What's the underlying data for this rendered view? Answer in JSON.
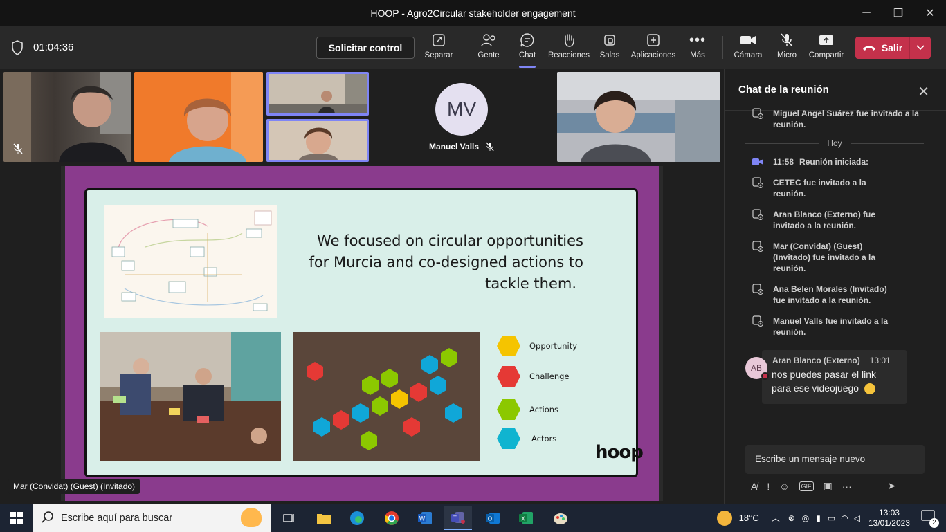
{
  "window": {
    "title": "HOOP - Agro2Circular stakeholder engagement",
    "minimize": "─",
    "maximize": "❐",
    "close": "✕"
  },
  "toolbar": {
    "timer": "01:04:36",
    "request_control": "Solicitar control",
    "buttons": {
      "separar": "Separar",
      "gente": "Gente",
      "chat": "Chat",
      "reacciones": "Reacciones",
      "salas": "Salas",
      "aplicaciones": "Aplicaciones",
      "mas": "Más",
      "camara": "Cámara",
      "micro": "Micro",
      "compartir": "Compartir"
    },
    "leave": "Salir"
  },
  "participants": {
    "manuel_initials": "MV",
    "manuel_name": "Manuel Valls",
    "presenter_tag": "Mar (Convidat) (Guest) (Invitado)"
  },
  "slide": {
    "heading_line1": "We focused on circular opportunities",
    "heading_line2": "for Murcia and co-designed actions to",
    "heading_line3": "tackle them.",
    "legend": [
      "Opportunity",
      "Challenge",
      "Actions",
      "Actors"
    ],
    "legend_colors": [
      "#f5c400",
      "#e53935",
      "#8cc800",
      "#10b4d0"
    ],
    "logo": "hoop"
  },
  "chat": {
    "title": "Chat de la reunión",
    "events_before": [
      "Miguel Angel Suárez fue invitado a la reunión."
    ],
    "day_divider": "Hoy",
    "meeting_started_time": "11:58",
    "meeting_started_text": "Reunión iniciada:",
    "events": [
      "CETEC fue invitado a la reunión.",
      "Aran Blanco (Externo) fue invitado a la reunión.",
      "Mar (Convidat) (Guest) (Invitado) fue invitado a la reunión.",
      "Ana Belen Morales (Invitado) fue invitado a la reunión.",
      "Manuel Valls fue invitado a la reunión."
    ],
    "message": {
      "avatar": "AB",
      "author": "Aran Blanco (Externo)",
      "time": "13:01",
      "text": "nos puedes pasar el link para ese videojuego"
    },
    "compose_placeholder": "Escribe un mensaje nuevo"
  },
  "taskbar": {
    "search_placeholder": "Escribe aquí para buscar",
    "temperature": "18°C",
    "time": "13:03",
    "date": "13/01/2023",
    "notifications": "2"
  }
}
